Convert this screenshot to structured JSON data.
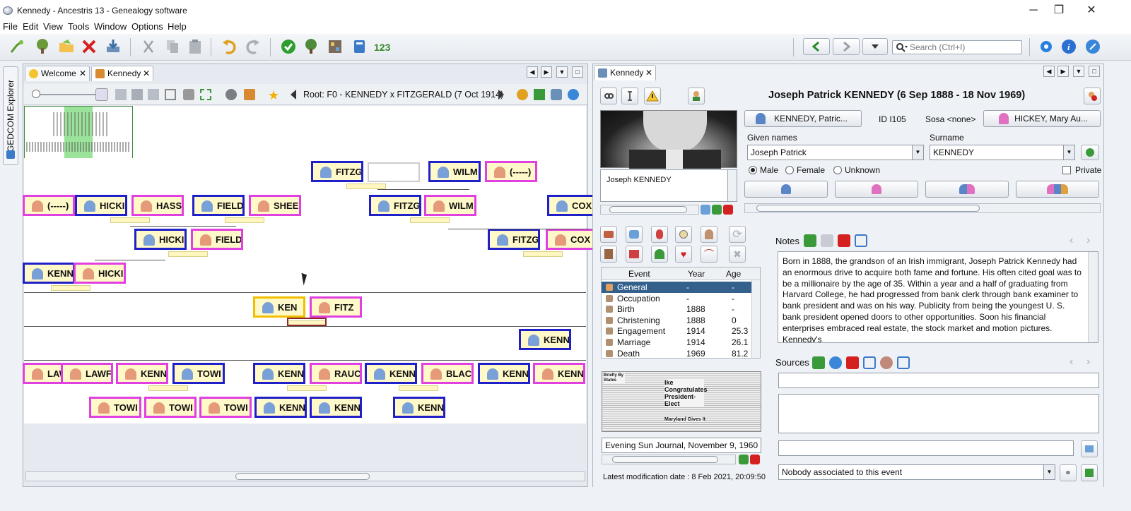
{
  "window": {
    "title": "Kennedy - Ancestris 13 - Genealogy software",
    "min": "─",
    "max": "❐",
    "close": "✕"
  },
  "menu": [
    "File",
    "Edit",
    "View",
    "Tools",
    "Window",
    "Options",
    "Help"
  ],
  "search": {
    "placeholder": "Search (Ctrl+I)"
  },
  "side_tab": "GEDCOM Explorer",
  "left_tabs": [
    {
      "label": "Welcome"
    },
    {
      "label": "Kennedy"
    }
  ],
  "tree": {
    "root_label": "Root: F0 - KENNEDY x FITZGERALD (7 Oct 1914)",
    "nodes": [
      {
        "name": "FITZG",
        "sex": "m"
      },
      {
        "name": "WILM",
        "sex": "m"
      },
      {
        "name": "(-----)",
        "sex": "f"
      },
      {
        "name": "(-----)",
        "sex": "f"
      },
      {
        "name": "HICKI",
        "sex": "m"
      },
      {
        "name": "HASS",
        "sex": "f"
      },
      {
        "name": "FIELD",
        "sex": "m"
      },
      {
        "name": "SHEE",
        "sex": "f"
      },
      {
        "name": "FITZG",
        "sex": "m"
      },
      {
        "name": "WILM",
        "sex": "f"
      },
      {
        "name": "COX",
        "sex": "m"
      },
      {
        "name": "HICKI",
        "sex": "m"
      },
      {
        "name": "FIELD",
        "sex": "f"
      },
      {
        "name": "FITZG",
        "sex": "m"
      },
      {
        "name": "COX",
        "sex": "f"
      },
      {
        "name": "KENN",
        "sex": "m"
      },
      {
        "name": "HICKI",
        "sex": "f"
      },
      {
        "name": "KEN",
        "sex": "m"
      },
      {
        "name": "FITZ",
        "sex": "f"
      },
      {
        "name": "KENN",
        "sex": "m"
      },
      {
        "name": "LAWF",
        "sex": "f"
      },
      {
        "name": "LAWF",
        "sex": "f"
      },
      {
        "name": "KENN",
        "sex": "f"
      },
      {
        "name": "TOWI",
        "sex": "m"
      },
      {
        "name": "KENN",
        "sex": "m"
      },
      {
        "name": "RAUC",
        "sex": "f"
      },
      {
        "name": "KENN",
        "sex": "m"
      },
      {
        "name": "BLAC",
        "sex": "f"
      },
      {
        "name": "KENN",
        "sex": "m"
      },
      {
        "name": "KENN",
        "sex": "f"
      },
      {
        "name": "TOWI",
        "sex": "f"
      },
      {
        "name": "TOWI",
        "sex": "f"
      },
      {
        "name": "TOWI",
        "sex": "f"
      },
      {
        "name": "KENN",
        "sex": "m"
      },
      {
        "name": "KENN",
        "sex": "m"
      },
      {
        "name": "KENN",
        "sex": "m"
      }
    ]
  },
  "right": {
    "tab": "Kennedy",
    "header": "Joseph Patrick KENNEDY (6 Sep 1888 - 18 Nov 1969)",
    "photo_caption": "Joseph KENNEDY",
    "father_btn": "KENNEDY, Patric...",
    "mother_btn": "HICKEY, Mary Au...",
    "id": "ID I105",
    "sosa": "Sosa <none>",
    "given_label": "Given names",
    "given": "Joseph Patrick",
    "surname_label": "Surname",
    "surname": "KENNEDY",
    "sex": {
      "male": "Male",
      "female": "Female",
      "unknown": "Unknown",
      "selected": "male"
    },
    "private": "Private",
    "events_header": {
      "event": "Event",
      "year": "Year",
      "age": "Age"
    },
    "events": [
      {
        "event": "General",
        "year": "-",
        "age": "-"
      },
      {
        "event": "Occupation",
        "year": "-",
        "age": "-"
      },
      {
        "event": "Birth",
        "year": "1888",
        "age": "-"
      },
      {
        "event": "Christening",
        "year": "1888",
        "age": "0"
      },
      {
        "event": "Engagement",
        "year": "1914",
        "age": "25.3"
      },
      {
        "event": "Marriage",
        "year": "1914",
        "age": "26.1"
      },
      {
        "event": "Death",
        "year": "1969",
        "age": "81.2"
      }
    ],
    "notes_label": "Notes",
    "notes_text": "Born in 1888, the grandson of an Irish immigrant, Joseph Patrick Kennedy had an enormous drive to acquire both fame and fortune.  His often cited goal was to be a millionaire by the age of 35.  Within a year and a half of graduating from Harvard College, he had progressed from bank clerk through bank  examiner to bank president and was on his way.  Publicity from being the youngest U. S. bank president opened doors to other opportunities. Soon his financial enterprises embraced real estate, the stock market and motion pictures.  Kennedy's",
    "sources_label": "Sources",
    "media_caption": "Evening Sun Journal, November 9, 1960",
    "newspaper_heading": "Ike Congratulates President-Elect",
    "newspaper_left": "Briefly By States",
    "newspaper_bottom": "Maryland Gives It",
    "association": "Nobody associated to this event",
    "modified": "Latest modification date : 8 Feb 2021, 20:09:50"
  },
  "colors": {
    "male": "#2020c8",
    "female": "#e040e0",
    "selected": "#f0c000",
    "node_fill": "#fff8c8",
    "selection_row": "#34618c"
  }
}
